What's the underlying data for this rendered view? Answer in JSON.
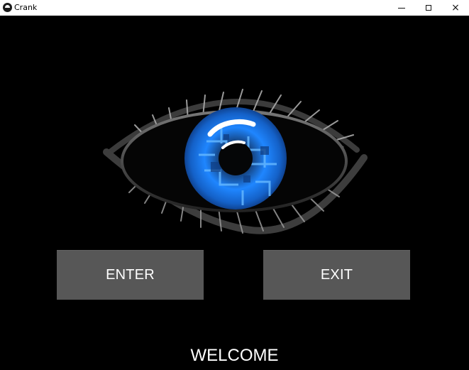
{
  "window": {
    "title": "Crank",
    "controls": {
      "minimize": "minimize-icon",
      "maximize": "maximize-icon",
      "close": "close-icon"
    }
  },
  "main": {
    "enter_label": "ENTER",
    "exit_label": "EXIT",
    "welcome_text": "WELCOME"
  },
  "colors": {
    "background": "#000000",
    "button_bg": "#575757",
    "button_text": "#ffffff",
    "eye_blue": "#1f86ff"
  }
}
